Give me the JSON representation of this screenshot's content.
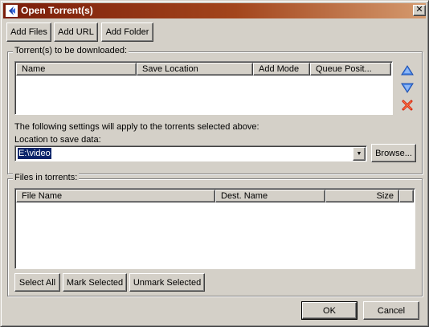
{
  "window": {
    "title": "Open Torrent(s)"
  },
  "toolbar": {
    "add_files": "Add Files",
    "add_url": "Add URL",
    "add_folder": "Add Folder"
  },
  "torrents_group": {
    "label": "Torrent(s) to be downloaded:",
    "columns": [
      "Name",
      "Save Location",
      "Add Mode",
      "Queue Posit..."
    ],
    "rows": []
  },
  "side_buttons": {
    "move_up": "arrow-up-icon",
    "move_down": "arrow-down-icon",
    "remove": "red-x-icon"
  },
  "settings": {
    "note": "The following settings will apply to the torrents selected above:",
    "location_label": "Location to save data:",
    "location_value": "E:\\video",
    "browse": "Browse..."
  },
  "files_group": {
    "label": "Files in torrents:",
    "columns": [
      "File Name",
      "Dest. Name",
      "Size"
    ],
    "rows": [],
    "select_all": "Select All",
    "mark_selected": "Mark Selected",
    "unmark_selected": "Unmark Selected"
  },
  "footer": {
    "ok": "OK",
    "cancel": "Cancel"
  },
  "colors": {
    "title_gradient_start": "#7a1d0a",
    "title_gradient_end": "#d59a6e",
    "arrow_blue": "#2f6fd6",
    "remove_red": "#d42a12"
  }
}
